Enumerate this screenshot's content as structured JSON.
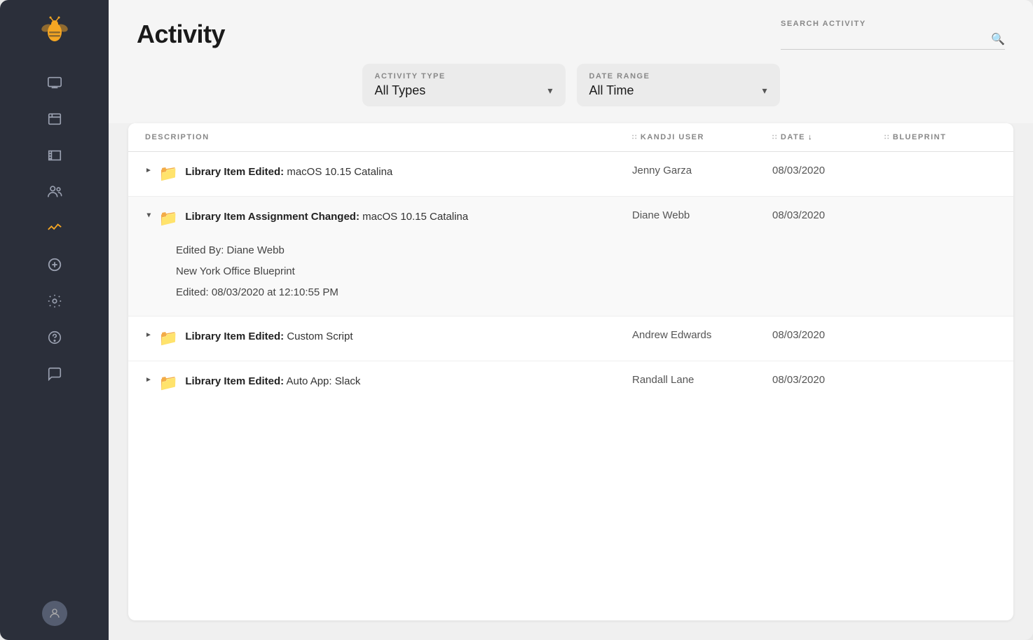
{
  "sidebar": {
    "logo_color": "#f5a623",
    "nav_items": [
      {
        "name": "devices-icon",
        "label": "Devices"
      },
      {
        "name": "library-icon",
        "label": "Library"
      },
      {
        "name": "blueprints-icon",
        "label": "Blueprints"
      },
      {
        "name": "users-icon",
        "label": "Users"
      },
      {
        "name": "activity-icon",
        "label": "Activity"
      },
      {
        "name": "add-icon",
        "label": "Add"
      },
      {
        "name": "settings-icon",
        "label": "Settings"
      },
      {
        "name": "help-icon",
        "label": "Help"
      },
      {
        "name": "messages-icon",
        "label": "Messages"
      }
    ]
  },
  "header": {
    "page_title": "Activity",
    "search_label": "SEARCH ACTIVITY",
    "search_placeholder": ""
  },
  "filters": {
    "activity_type_label": "ACTIVITY TYPE",
    "activity_type_value": "All Types",
    "date_range_label": "DATE RANGE",
    "date_range_value": "All Time"
  },
  "table": {
    "columns": [
      {
        "key": "description",
        "label": "DESCRIPTION"
      },
      {
        "key": "user",
        "label": "KANDJI USER"
      },
      {
        "key": "date",
        "label": "DATE"
      },
      {
        "key": "blueprint",
        "label": "BLUEPRINT"
      }
    ],
    "rows": [
      {
        "id": 1,
        "expanded": false,
        "description_bold": "Library Item Edited:",
        "description_rest": " macOS 10.15 Catalina",
        "user": "Jenny Garza",
        "date": "08/03/2020",
        "blueprint": ""
      },
      {
        "id": 2,
        "expanded": true,
        "description_bold": "Library Item Assignment Changed:",
        "description_rest": " macOS 10.15 Catalina",
        "user": "Diane Webb",
        "date": "08/03/2020",
        "blueprint": "",
        "expanded_lines": [
          "Edited By: Diane Webb",
          "New York Office Blueprint",
          "Edited: 08/03/2020 at 12:10:55 PM"
        ]
      },
      {
        "id": 3,
        "expanded": false,
        "description_bold": "Library Item Edited:",
        "description_rest": " Custom Script",
        "user": "Andrew Edwards",
        "date": "08/03/2020",
        "blueprint": ""
      },
      {
        "id": 4,
        "expanded": false,
        "description_bold": "Library Item Edited:",
        "description_rest": " Auto App: Slack",
        "user": "Randall Lane",
        "date": "08/03/2020",
        "blueprint": ""
      }
    ]
  }
}
